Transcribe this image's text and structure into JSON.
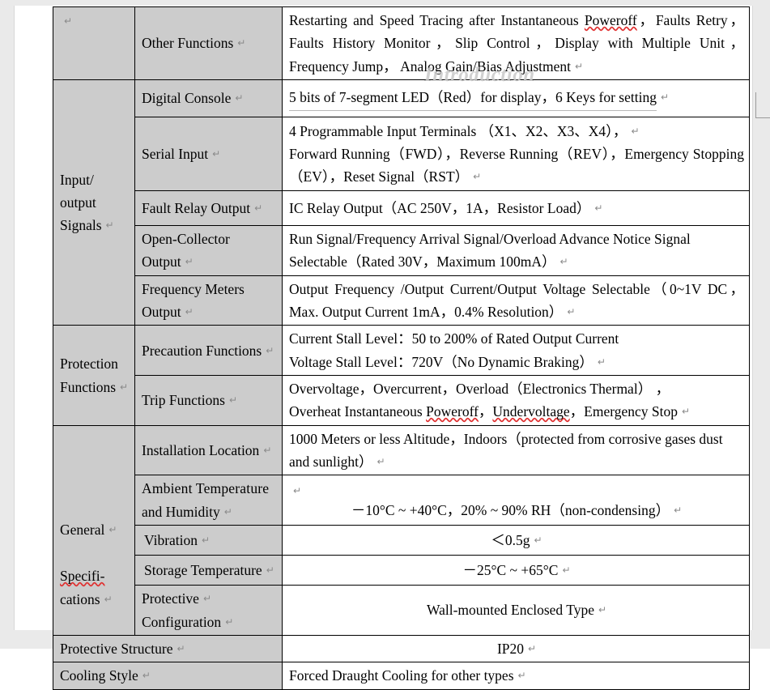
{
  "document": {
    "watermark": "Introduction",
    "pilcrow": "↵"
  },
  "table": {
    "rows": [
      {
        "group": "",
        "group_pilcrow": "↵",
        "sub": "Other Functions",
        "value": "Restarting and Speed Tracing after Instantaneous Poweroff，Faults Retry，Faults History Monitor，Slip Control，Display with Multiple Unit，Frequency Jump， Analog Gain/Bias Adjustment",
        "value_misspelled": "Poweroff"
      },
      {
        "group": "Input/ output Signals",
        "sub": "Digital Console",
        "value": "5 bits of 7-segment LED（Red）for display，6 Keys for setting"
      },
      {
        "sub": "Serial Input",
        "value": "4 Programmable Input Terminals （X1、X2、X3、X4），",
        "value_line2": "Forward Running（FWD），Reverse Running（REV），Emergency Stopping（EV），Reset Signal（RST）"
      },
      {
        "sub": "Fault Relay Output",
        "value": "IC Relay Output（AC 250V，1A，Resistor Load）"
      },
      {
        "sub": "Open-Collector Output",
        "value": "Run Signal/Frequency Arrival Signal/Overload Advance Notice Signal Selectable（Rated 30V，Maximum 100mA）"
      },
      {
        "sub": "Frequency Meters Output",
        "value": "Output Frequency /Output Current/Output Voltage Selectable（0~1V DC，Max. Output Current 1mA，0.4% Resolution）"
      },
      {
        "group": "Protection Functions",
        "sub": "Precaution Functions",
        "value_line1": "Current Stall Level：50 to 200% of Rated Output Current",
        "value_line2": "Voltage Stall Level：720V（No Dynamic Braking）"
      },
      {
        "sub": "Trip Functions",
        "value_line1": "Overvoltage，Overcurrent，Overload（Electronics    Thermal）  ，",
        "value_line2_a": "Overheat Instantaneous ",
        "value_line2_b": "Poweroff",
        "value_line2_c": "，",
        "value_line2_d": "Undervoltage",
        "value_line2_e": "，Emergency Stop"
      },
      {
        "group": "General Specifi- cations",
        "group_part1": "General",
        "group_part2": "Specifi-",
        "group_part3": "cations",
        "sub": "Installation Location",
        "value": "1000 Meters or less Altitude，Indoors（protected from corrosive gases dust and sunlight）"
      },
      {
        "sub": "Ambient Temperature and Humidity",
        "value": "－10°C ~ +40°C，20% ~ 90% RH（non-condensing）"
      },
      {
        "sub": "Vibration",
        "value": "＜0.5g"
      },
      {
        "sub": "Storage Temperature",
        "value": "－25°C ~ +65°C"
      },
      {
        "sub": "Protective Configuration",
        "sub_part1": "Protective",
        "sub_part2": "Configuration",
        "value": "Wall-mounted Enclosed Type"
      },
      {
        "span_label": "Protective Structure",
        "value": "IP20"
      },
      {
        "span_label": "Cooling Style",
        "value": "Forced Draught Cooling for other types"
      }
    ]
  },
  "colors": {
    "header_fill": "#cccccc",
    "page_background": "#ffffff",
    "app_chrome": "#eaeaea",
    "spellcheck_underline": "#e03030",
    "watermark": "#c9c9c9",
    "pilcrow": "#8a8a8a"
  }
}
